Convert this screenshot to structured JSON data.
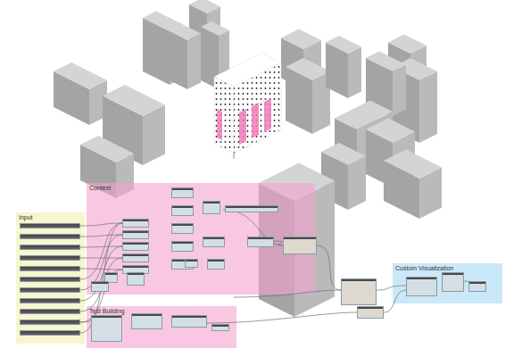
{
  "groups": [
    {
      "title": "Input",
      "color": "#f6f6cf"
    },
    {
      "title": "Context",
      "color": "#f4a3cf"
    },
    {
      "title": "Test Building",
      "color": "#f4a3cf"
    },
    {
      "title": "Custom Visualization",
      "color": "#bde2f6"
    }
  ]
}
